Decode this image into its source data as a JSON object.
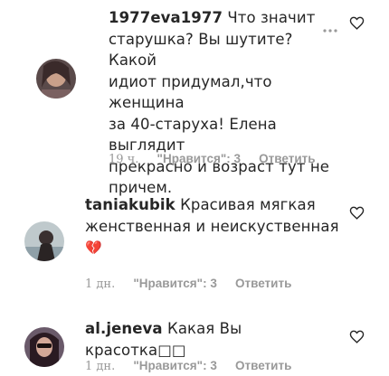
{
  "comments": [
    {
      "username": "1977eva1977",
      "text_lines": [
        "Что значит",
        "старушка? Вы шутите? Какой",
        "идиот придумал,что женщина",
        "за 40-старуха! Елена выглядит",
        "прекрасно и возраст тут не",
        "причем."
      ],
      "time": "19 ч.",
      "likes": "\"Нравится\": 3",
      "reply": "Ответить",
      "more_icon": "ellipsis-icon",
      "heart_icon": "heart-outline-icon"
    },
    {
      "username": "taniakubik",
      "text_lines": [
        "Красивая мягкая",
        "женственная и неискуственная"
      ],
      "emoji": "💔",
      "time": "1 дн.",
      "likes": "\"Нравится\": 3",
      "reply": "Ответить",
      "heart_icon": "heart-outline-icon"
    },
    {
      "username": "al.jeneva",
      "text_lines": [
        "Какая Вы красотка□□"
      ],
      "time": "1 дн.",
      "likes": "\"Нравится\": 3",
      "reply": "Ответить",
      "heart_icon": "heart-outline-icon"
    }
  ]
}
